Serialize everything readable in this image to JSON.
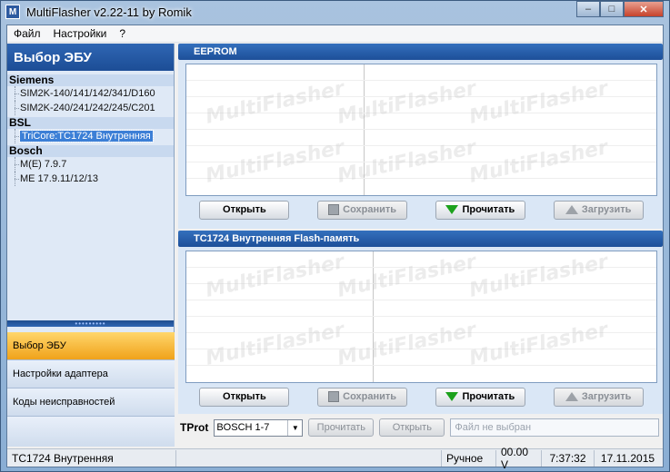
{
  "window": {
    "title": "MultiFlasher v2.22-11 by Romik",
    "icon_glyph": "M"
  },
  "menu": [
    "Файл",
    "Настройки",
    "?"
  ],
  "left": {
    "header": "Выбор ЭБУ",
    "groups": [
      {
        "name": "Siemens",
        "items": [
          "SIM2K-140/141/142/341/D160",
          "SIM2K-240/241/242/245/C201"
        ]
      },
      {
        "name": "BSL",
        "items": [
          "TriCore:TC1724 Внутренняя"
        ]
      },
      {
        "name": "Bosch",
        "items": [
          "M(E) 7.9.7",
          "ME 17.9.11/12/13"
        ]
      }
    ],
    "selected_item": "TriCore:TC1724 Внутренняя",
    "nav": [
      "Выбор ЭБУ",
      "Настройки адаптера",
      "Коды неисправностей"
    ]
  },
  "eeprom": {
    "title": "EEPROM",
    "buttons": {
      "open": "Открыть",
      "save": "Сохранить",
      "read": "Прочитать",
      "write": "Загрузить"
    }
  },
  "flash": {
    "title": "TC1724 Внутренняя Flash-память",
    "buttons": {
      "open": "Открыть",
      "save": "Сохранить",
      "read": "Прочитать",
      "write": "Загрузить"
    }
  },
  "watermark": "MultiFlasher",
  "tprot": {
    "label": "TProt",
    "selected": "BOSCH 1-7",
    "read_button": "Прочитать",
    "open_button": "Открыть",
    "file_placeholder": "Файл не выбран"
  },
  "status": {
    "ecu": "TC1724 Внутренняя",
    "mode": "Ручное",
    "voltage": "00.00 V",
    "time": "7:37:32",
    "date": "17.11.2015"
  },
  "colors": {
    "accent": "#1d4f99",
    "active_nav": "#f0a21a",
    "read_arrow": "#1ca11c"
  }
}
